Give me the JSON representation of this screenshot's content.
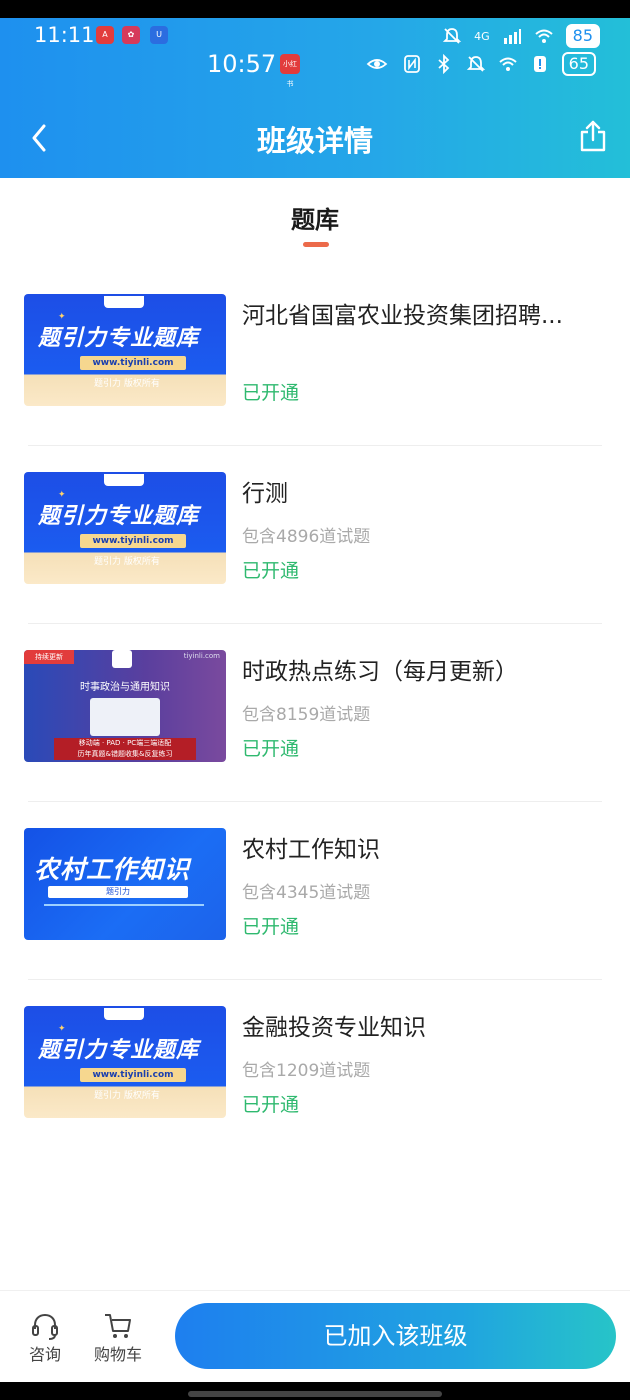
{
  "status_bar": {
    "outer_time": "11:11",
    "outer_battery": "85",
    "outer_network": "4G",
    "inner_time": "10:57",
    "inner_badge": "小红书",
    "inner_battery": "65"
  },
  "header": {
    "title": "班级详情"
  },
  "tab": {
    "label": "题库"
  },
  "items": [
    {
      "title": "河北省国富农业投资集团招聘...",
      "count": "",
      "status": "已开通",
      "thumb": {
        "type": "blue",
        "big": "题引力专业题库",
        "url": "www.tiyinli.com",
        "copy": "题引力 版权所有"
      }
    },
    {
      "title": "行测",
      "count": "包含4896道试题",
      "status": "已开通",
      "thumb": {
        "type": "blue",
        "big": "题引力专业题库",
        "url": "www.tiyinli.com",
        "copy": "题引力 版权所有"
      }
    },
    {
      "title": "时政热点练习（每月更新）",
      "count": "包含8159道试题",
      "status": "已开通",
      "thumb": {
        "type": "purple",
        "tag": "持续更新",
        "site": "tiyinli.com",
        "sub": "时事政治与通用知识",
        "bar1": "移动端 · PAD · PC端三端适配",
        "bar2": "历年真题&错题收集&反复练习"
      }
    },
    {
      "title": "农村工作知识",
      "count": "包含4345道试题",
      "status": "已开通",
      "thumb": {
        "type": "rural",
        "big": "农村工作知识",
        "ribbon": "题引力"
      }
    },
    {
      "title": "金融投资专业知识",
      "count": "包含1209道试题",
      "status": "已开通",
      "thumb": {
        "type": "blue",
        "big": "题引力专业题库",
        "url": "www.tiyinli.com",
        "copy": "题引力 版权所有"
      }
    }
  ],
  "bottom": {
    "consult_label": "咨询",
    "cart_label": "购物车",
    "join_label": "已加入该班级"
  },
  "colors": {
    "header_start": "#1e90ef",
    "header_end": "#23bfd8",
    "status_green": "#2fb96f",
    "tab_indicator": "#ec6a4a"
  }
}
